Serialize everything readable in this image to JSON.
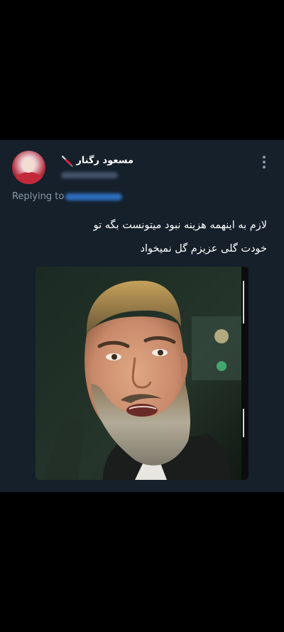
{
  "tweet": {
    "author": {
      "display_name": "مسعود رگنار",
      "name_emoji": "syringe-icon"
    },
    "reply_prefix": "Replying to",
    "text_lines": [
      "لازم به اینهمه هزینه نبود میتونست بگه تو",
      "خودت گلی عزیزم گل نمیخواد"
    ],
    "media": {
      "kind": "photo"
    },
    "menu_icon": "more-vertical-icon"
  },
  "colors": {
    "background": "#000000",
    "card": "#15202b",
    "text_primary": "#ffffff",
    "text_secondary": "#8b98a5",
    "link": "#1d9bf0"
  }
}
